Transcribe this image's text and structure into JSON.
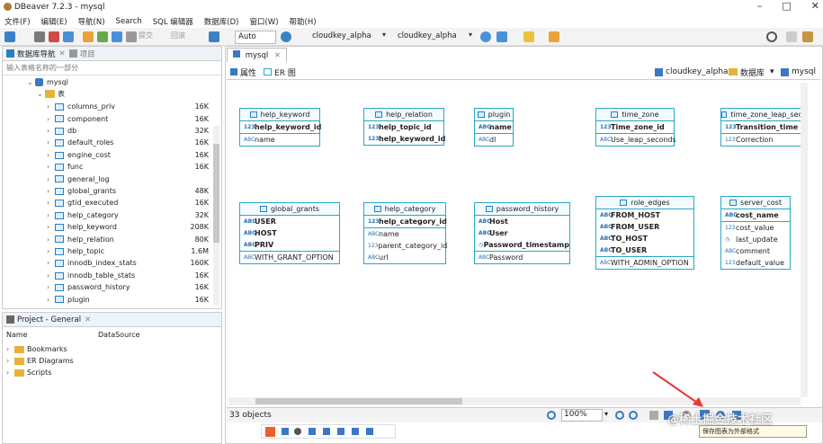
{
  "window": {
    "title": "DBeaver 7.2.3 - mysql"
  },
  "menu": [
    "文件(F)",
    "编辑(E)",
    "导航(N)",
    "Search",
    "SQL 编辑器",
    "数据库(D)",
    "窗口(W)",
    "帮助(H)"
  ],
  "toolbar": {
    "auto": "Auto",
    "conn1": "cloudkey_alpha",
    "conn2": "cloudkey_alpha",
    "commit": "提交",
    "rollback": "回滚"
  },
  "navigator": {
    "title": "数据库导航",
    "title2": "项目",
    "filter_placeholder": "输入表格名称的一部分",
    "db": "mysql",
    "tables_folder": "表",
    "tables": [
      {
        "name": "columns_priv",
        "size": "16K"
      },
      {
        "name": "component",
        "size": "16K"
      },
      {
        "name": "db",
        "size": "32K"
      },
      {
        "name": "default_roles",
        "size": "16K"
      },
      {
        "name": "engine_cost",
        "size": "16K"
      },
      {
        "name": "func",
        "size": "16K"
      },
      {
        "name": "general_log",
        "size": ""
      },
      {
        "name": "global_grants",
        "size": "48K"
      },
      {
        "name": "gtid_executed",
        "size": "16K"
      },
      {
        "name": "help_category",
        "size": "32K"
      },
      {
        "name": "help_keyword",
        "size": "208K"
      },
      {
        "name": "help_relation",
        "size": "80K"
      },
      {
        "name": "help_topic",
        "size": "1.6M"
      },
      {
        "name": "innodb_index_stats",
        "size": "160K"
      },
      {
        "name": "innodb_table_stats",
        "size": "16K"
      },
      {
        "name": "password_history",
        "size": "16K"
      },
      {
        "name": "plugin",
        "size": "16K"
      }
    ]
  },
  "project": {
    "title": "Project - General",
    "col_name": "Name",
    "col_source": "DataSource",
    "items": [
      "Bookmarks",
      "ER Diagrams",
      "Scripts"
    ]
  },
  "editor": {
    "tab": "mysql",
    "subtab_props": "属性",
    "subtab_er": "ER 图",
    "crumb_conn": "cloudkey_alpha",
    "crumb_db": "数据库",
    "crumb_schema": "mysql"
  },
  "entities": [
    {
      "title": "help_keyword",
      "fields": [
        {
          "t": "123",
          "n": "help_keyword_id",
          "b": true
        }
      ],
      "fields2": [
        {
          "t": "ABC",
          "n": "name"
        }
      ]
    },
    {
      "title": "help_relation",
      "fields": [
        {
          "t": "123",
          "n": "help_topic_id",
          "b": true
        },
        {
          "t": "123",
          "n": "help_keyword_id",
          "b": true
        }
      ],
      "fields2": []
    },
    {
      "title": "plugin",
      "fields": [
        {
          "t": "ABC",
          "n": "name",
          "b": true
        }
      ],
      "fields2": [
        {
          "t": "ABC",
          "n": "dl"
        }
      ]
    },
    {
      "title": "time_zone",
      "fields": [
        {
          "t": "123",
          "n": "Time_zone_id",
          "b": true
        }
      ],
      "fields2": [
        {
          "t": "ABC",
          "n": "Use_leap_seconds"
        }
      ]
    },
    {
      "title": "time_zone_leap_sec",
      "fields": [
        {
          "t": "123",
          "n": "Transition_time",
          "b": true
        }
      ],
      "fields2": [
        {
          "t": "123",
          "n": "Correction"
        }
      ]
    },
    {
      "title": "global_grants",
      "fields": [
        {
          "t": "ABC",
          "n": "USER",
          "b": true
        },
        {
          "t": "ABC",
          "n": "HOST",
          "b": true
        },
        {
          "t": "ABC",
          "n": "PRIV",
          "b": true
        }
      ],
      "fields2": [
        {
          "t": "ABC",
          "n": "WITH_GRANT_OPTION"
        }
      ]
    },
    {
      "title": "help_category",
      "fields": [
        {
          "t": "123",
          "n": "help_category_id",
          "b": true
        }
      ],
      "fields2": [
        {
          "t": "ABC",
          "n": "name"
        },
        {
          "t": "123",
          "n": "parent_category_id"
        },
        {
          "t": "ABC",
          "n": "url"
        }
      ]
    },
    {
      "title": "password_history",
      "fields": [
        {
          "t": "ABC",
          "n": "Host",
          "b": true
        },
        {
          "t": "ABC",
          "n": "User",
          "b": true
        },
        {
          "t": "◷",
          "n": "Password_timestamp",
          "b": true
        }
      ],
      "fields2": [
        {
          "t": "ABC",
          "n": "Password"
        }
      ]
    },
    {
      "title": "role_edges",
      "fields": [
        {
          "t": "ABC",
          "n": "FROM_HOST",
          "b": true
        },
        {
          "t": "ABC",
          "n": "FROM_USER",
          "b": true
        },
        {
          "t": "ABC",
          "n": "TO_HOST",
          "b": true
        },
        {
          "t": "ABC",
          "n": "TO_USER",
          "b": true
        }
      ],
      "fields2": [
        {
          "t": "ABC",
          "n": "WITH_ADMIN_OPTION"
        }
      ]
    },
    {
      "title": "server_cost",
      "fields": [
        {
          "t": "ABC",
          "n": "cost_name",
          "b": true
        }
      ],
      "fields2": [
        {
          "t": "123",
          "n": "cost_value"
        },
        {
          "t": "◷",
          "n": "last_update"
        },
        {
          "t": "ABC",
          "n": "comment"
        },
        {
          "t": "123",
          "n": "default_value"
        }
      ]
    }
  ],
  "status": {
    "objects": "33 objects",
    "zoom": "100%"
  },
  "tooltip": "保存图表为外部格式",
  "watermark": "@稀土掘金技术社区",
  "colors": {
    "entity_border": "#27a9c7",
    "accent": "#2a7fbf",
    "annotation_arrow": "#e53935"
  }
}
